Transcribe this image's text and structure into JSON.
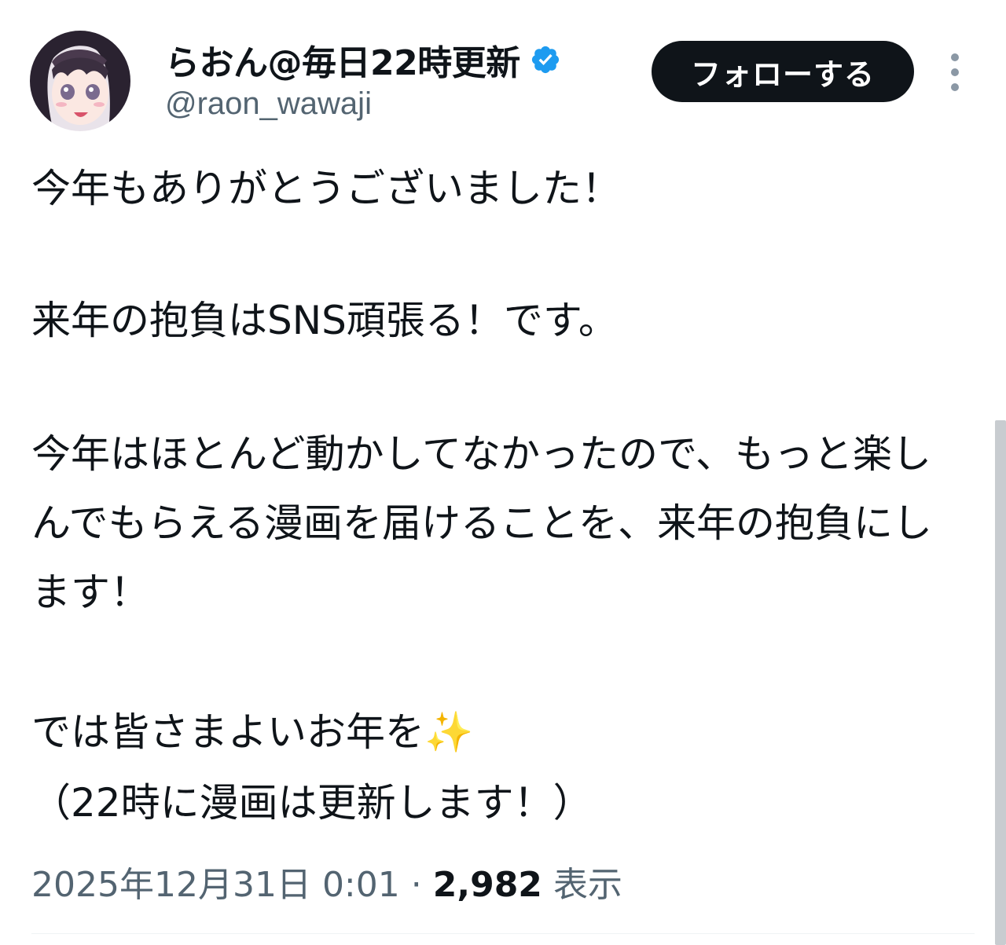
{
  "user": {
    "display_name": "らおん@毎日22時更新",
    "handle": "@raon_wawaji",
    "verified_icon": "verified-badge-icon",
    "avatar": "avatar-illustration"
  },
  "actions": {
    "follow_label": "フォローする",
    "more_icon": "vertical-dots-icon"
  },
  "tweet": {
    "paragraph_1": "今年もありがとうございました！",
    "paragraph_2": "来年の抱負はSNS頑張る！です。",
    "paragraph_3": "今年はほとんど動かしてなかったので、もっと楽しんでもらえる漫画を届けることを、来年の抱負にします！",
    "paragraph_4": "では皆さまよいお年を✨",
    "paragraph_5": "（22時に漫画は更新します！）"
  },
  "meta": {
    "timestamp": "2025年12月31日 0:01",
    "separator": "·",
    "views_count": "2,982",
    "views_label": "表示"
  },
  "colors": {
    "text_primary": "#0f1419",
    "text_secondary": "#536471",
    "verified_blue": "#1d9bf0",
    "button_bg": "#0f1419"
  }
}
